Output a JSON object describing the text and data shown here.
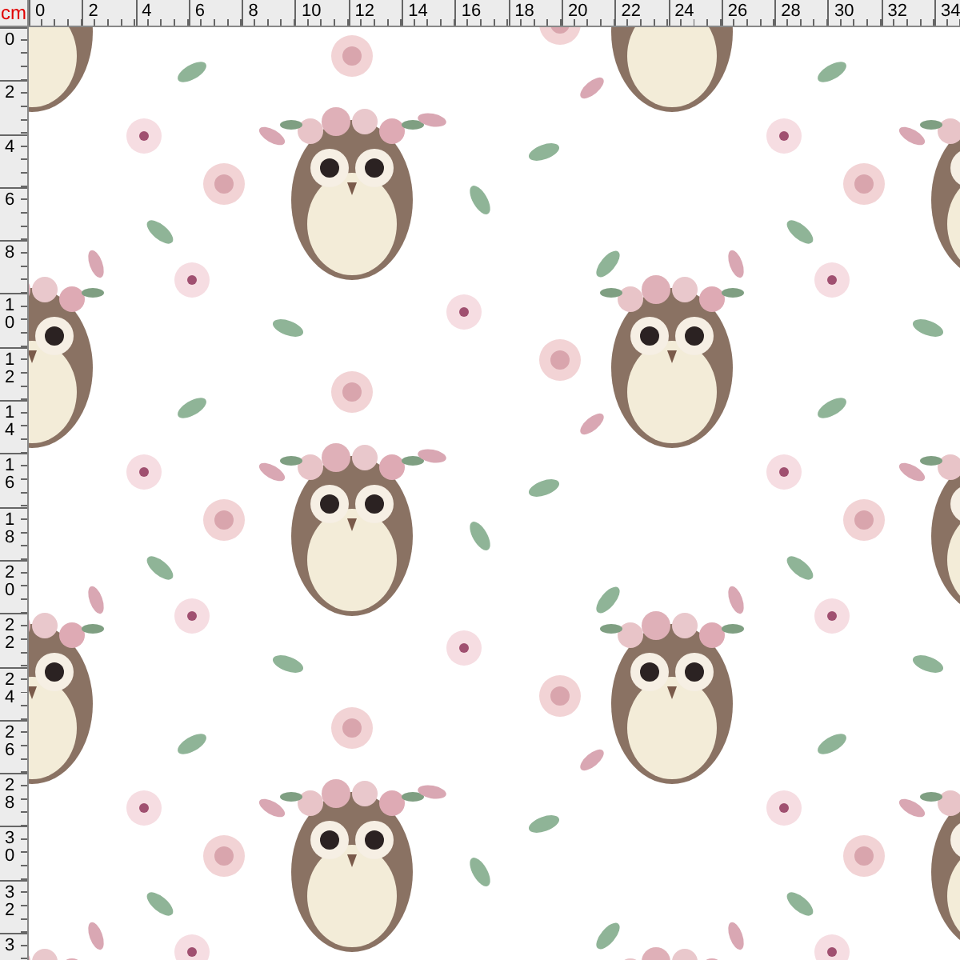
{
  "ruler": {
    "unit": "cm",
    "top_labels": [
      "0",
      "2",
      "4",
      "6",
      "8",
      "10",
      "12",
      "14",
      "16",
      "18",
      "20",
      "22",
      "24",
      "26",
      "28",
      "30",
      "32",
      "34"
    ],
    "left_labels": [
      "0",
      "2",
      "4",
      "6",
      "8",
      "10",
      "12",
      "14",
      "16",
      "18",
      "20",
      "22",
      "24",
      "26",
      "28",
      "30",
      "32",
      "3"
    ]
  }
}
